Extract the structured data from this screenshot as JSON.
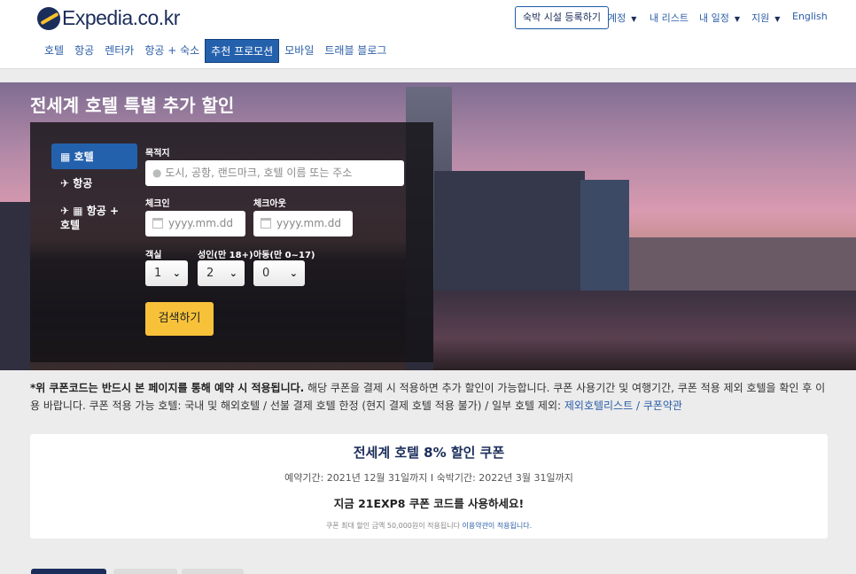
{
  "header": {
    "logo": "Expedia.co.kr",
    "register_property": "숙박 시설 등록하기",
    "top_links": [
      {
        "label": "계정",
        "dropdown": true
      },
      {
        "label": "내 리스트",
        "dropdown": false
      },
      {
        "label": "내 일정",
        "dropdown": true
      },
      {
        "label": "지원",
        "dropdown": true
      },
      {
        "label": "English",
        "dropdown": false
      }
    ],
    "nav": [
      {
        "label": "호텔"
      },
      {
        "label": "항공"
      },
      {
        "label": "렌터카"
      },
      {
        "label": "항공 + 숙소"
      },
      {
        "label": "추천 프로모션",
        "active": true
      },
      {
        "label": "모바일"
      },
      {
        "label": "트래블 블로그"
      }
    ]
  },
  "hero": {
    "title": "전세계 호텔 특별 추가 할인",
    "tabs": [
      {
        "label": "호텔",
        "icon": "building-icon",
        "active": true
      },
      {
        "label": "항공",
        "icon": "plane-icon"
      },
      {
        "label": "항공 + 호텔",
        "icon": "plane-building-icon"
      }
    ],
    "destination_label": "목적지",
    "destination_placeholder": "도시, 공항, 랜드마크, 호텔 이름 또는 주소",
    "checkin_label": "체크인",
    "checkin_placeholder": "yyyy.mm.dd",
    "checkout_label": "체크아웃",
    "checkout_placeholder": "yyyy.mm.dd",
    "rooms_label": "객실",
    "rooms_value": "1",
    "adults_label": "성인(만 18+)",
    "adults_value": "2",
    "children_label": "아동(만 0~17)",
    "children_value": "0",
    "search_button": "검색하기"
  },
  "notice": {
    "bold": "*위 쿠폰코드는 반드시 본 페이지를 통해 예약 시 적용됩니다.",
    "text": " 해당 쿠폰을 결제 시 적용하면 추가 할인이 가능합니다. 쿠폰 사용기간 및 여행기간, 쿠폰 적용 제외 호텔을 확인 후 이용 바랍니다. 쿠폰 적용 가능 호텔: 국내 및 해외호텔 / 선불 결제 호텔 한정 (현지 결제 호텔 적용 불가) / 일부 호텔 제외: ",
    "link1": "제외호텔리스트",
    "sep": " / ",
    "link2": "쿠폰약관"
  },
  "coupon": {
    "title": "전세계 호텔 8% 할인 쿠폰",
    "period": "예약기간: 2021년 12월 31일까지 I 숙박기간: 2022년 3월 31일까지",
    "code_text": "지금 21EXP8 쿠폰 코드를 사용하세요!",
    "fine_print": "쿠폰 최대 할인 금액 50,000원이 적용됩니다 ",
    "terms_link": "이용약관이 적용됩니다."
  },
  "colors": {
    "brand_navy": "#1b2d5b",
    "accent_blue": "#2461ad",
    "button_yellow": "#f7c23a"
  }
}
